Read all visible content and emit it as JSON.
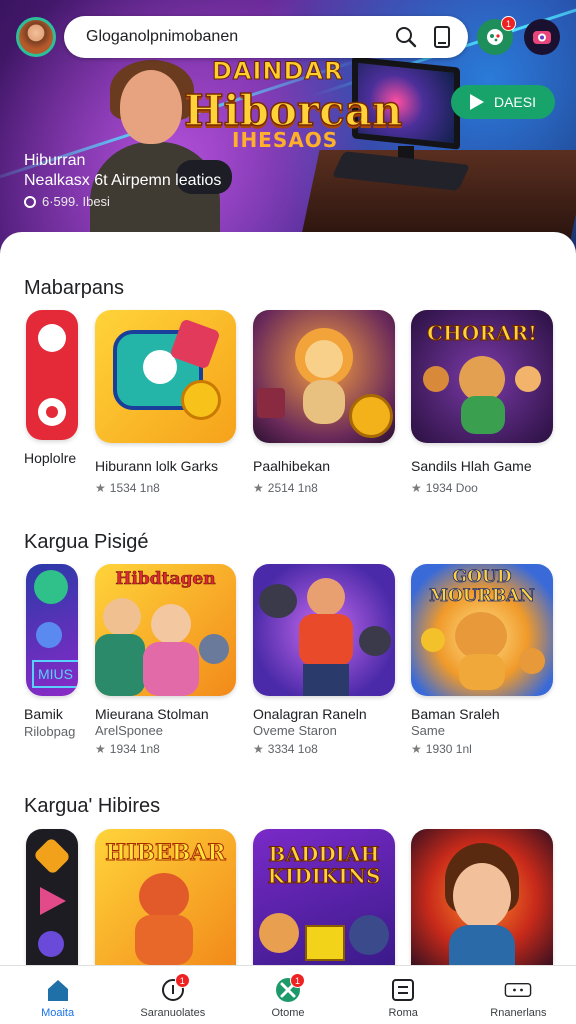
{
  "search": {
    "text": "Gloganolpnimobanen"
  },
  "topbar": {
    "notifications_badge": "1"
  },
  "hero": {
    "title_top": "DAINDAR",
    "title": "Hiborcan",
    "title_sub": "IHESAOS",
    "kicker": "Hiburran",
    "line": "Nealkasx 6t Airpemn leatios",
    "stat": "6·599. Ibesi",
    "cta_label": "DAESI"
  },
  "sections": [
    {
      "title": "Mabarpans",
      "items": [
        {
          "name": "Hoplolre",
          "sub": "",
          "rating": ""
        },
        {
          "name": "Hiburann lolk Garks",
          "sub": "",
          "rating": "1534 1n8"
        },
        {
          "name": "Paalhibekan",
          "sub": "",
          "rating": "2514 1n8"
        },
        {
          "name": "Sandils Hlah Game",
          "sub": "",
          "rating": "1934 Doo",
          "art_text": "CHORAR!"
        }
      ]
    },
    {
      "title": "Kargua Pisigé",
      "items": [
        {
          "name": "Bamik",
          "sub": "Rilobpag",
          "rating": "",
          "art_text": "MIUS"
        },
        {
          "name": "Mieurana Stolman",
          "sub": "ArelSponee",
          "rating": "1934 1n8",
          "art_text": "Hibdtagen"
        },
        {
          "name": "Onalagran Raneln",
          "sub": "Oveme Staron",
          "rating": "3334 1o8"
        },
        {
          "name": "Baman Sraleh",
          "sub": "Same",
          "rating": "1930 1nl",
          "art_text": "GOUD MOURBAN"
        }
      ]
    },
    {
      "title": "Kargua' Hibires",
      "items": [
        {
          "name": "",
          "sub": "",
          "rating": ""
        },
        {
          "name": "",
          "sub": "",
          "rating": "",
          "art_text": "HIBEBAR"
        },
        {
          "name": "",
          "sub": "",
          "rating": "",
          "art_text": "BADDIAH KIDIKINS"
        },
        {
          "name": "",
          "sub": "",
          "rating": ""
        }
      ]
    }
  ],
  "nav": [
    {
      "label": "Moaita",
      "icon": "home-icon",
      "active": true
    },
    {
      "label": "Saranuolates",
      "icon": "circle-badge-icon",
      "badge": "1"
    },
    {
      "label": "Otome",
      "icon": "games-icon",
      "badge": "1"
    },
    {
      "label": "Roma",
      "icon": "list-icon"
    },
    {
      "label": "Rnanerlans",
      "icon": "menu-dots-icon"
    }
  ],
  "colors": {
    "accent": "#1a73e8",
    "cta": "#18a36a",
    "badge": "#e22222",
    "hero_title": "#ffd23a"
  }
}
